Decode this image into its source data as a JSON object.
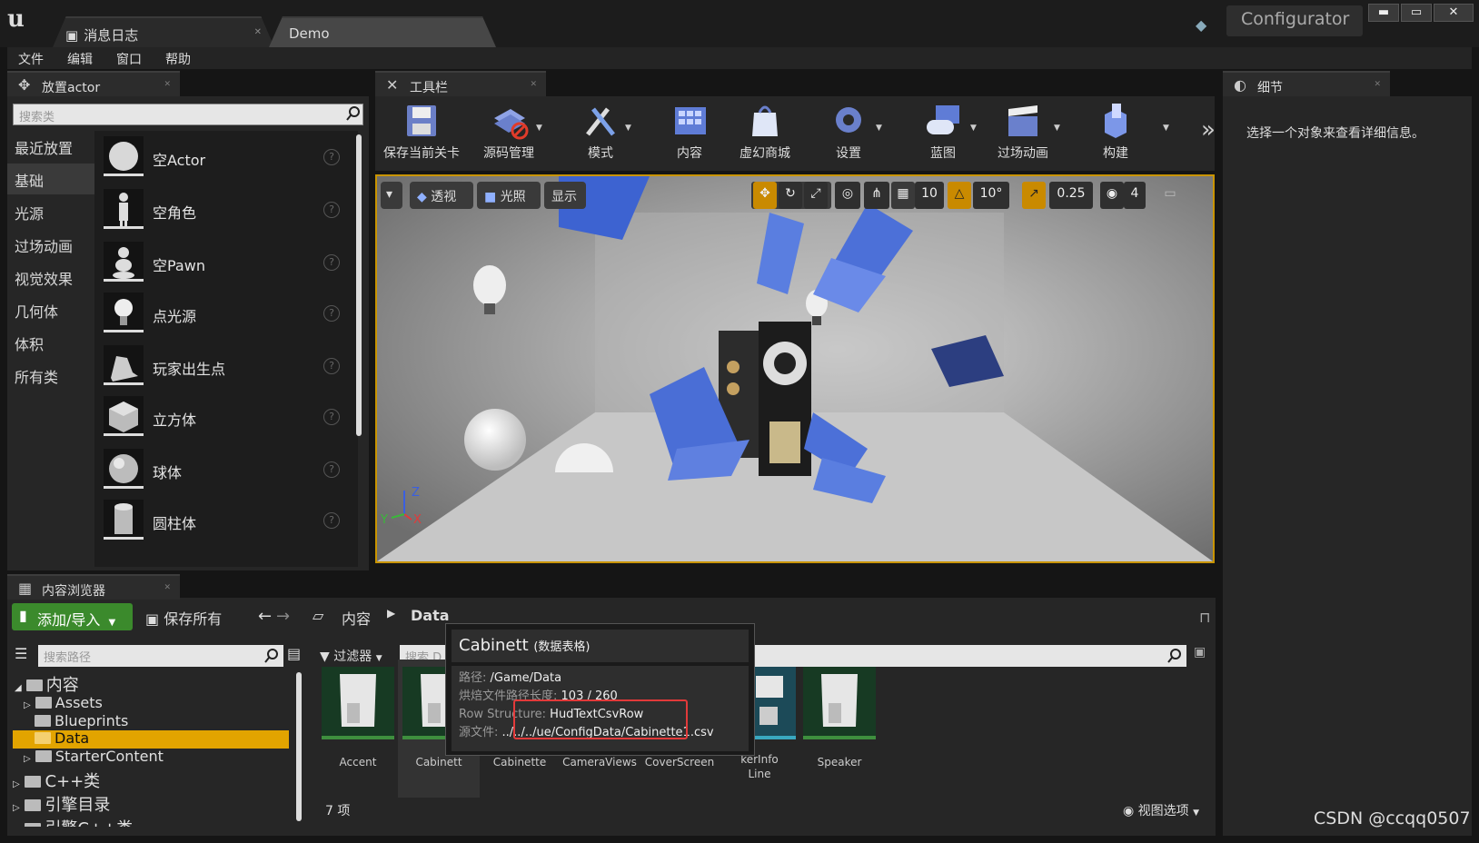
{
  "window": {
    "tabs": [
      {
        "label": "消息日志"
      },
      {
        "label": "Demo"
      }
    ],
    "project_name": "Configurator",
    "controls": {
      "minimize": "▬",
      "maximize": "▭",
      "close": "✕"
    }
  },
  "menu": [
    "文件",
    "编辑",
    "窗口",
    "帮助"
  ],
  "place_panel": {
    "title": "放置actor",
    "search_placeholder": "搜索类",
    "categories": [
      "最近放置",
      "基础",
      "光源",
      "过场动画",
      "视觉效果",
      "几何体",
      "体积",
      "所有类"
    ],
    "selected_category": "基础",
    "actors": [
      "空Actor",
      "空角色",
      "空Pawn",
      "点光源",
      "玩家出生点",
      "立方体",
      "球体",
      "圆柱体"
    ],
    "help_glyph": "?"
  },
  "toolbar": {
    "title": "工具栏",
    "buttons": [
      {
        "label": "保存当前关卡",
        "icon": "save-icon"
      },
      {
        "label": "源码管理",
        "icon": "source-control-icon"
      },
      {
        "label": "模式",
        "icon": "modes-icon"
      },
      {
        "label": "内容",
        "icon": "content-icon"
      },
      {
        "label": "虚幻商城",
        "icon": "marketplace-icon"
      },
      {
        "label": "设置",
        "icon": "settings-icon"
      },
      {
        "label": "蓝图",
        "icon": "blueprint-icon"
      },
      {
        "label": "过场动画",
        "icon": "cinematics-icon"
      },
      {
        "label": "构建",
        "icon": "build-icon"
      }
    ],
    "more": "»"
  },
  "viewport": {
    "buttons": {
      "perspective": "透视",
      "lighting": "光照",
      "show": "显示"
    },
    "grid_snap": "10",
    "rotation_snap": "10°",
    "scale_snap": "0.25",
    "camera_speed": "4",
    "axis_labels": {
      "z": "Z",
      "x": "X",
      "y": "Y"
    }
  },
  "details": {
    "title": "细节",
    "empty_message": "选择一个对象来查看详细信息。"
  },
  "content_browser": {
    "title": "内容浏览器",
    "add_import": "添加/导入",
    "save_all": "保存所有",
    "breadcrumb": [
      "内容",
      "Data"
    ],
    "search_path_placeholder": "搜索路径",
    "filter_label": "过滤器",
    "search_assets_placeholder": "搜索 D",
    "tree": [
      {
        "label": "内容",
        "level": 0,
        "expanded": true
      },
      {
        "label": "Assets",
        "level": 1
      },
      {
        "label": "Blueprints",
        "level": 1
      },
      {
        "label": "Data",
        "level": 1,
        "selected": true
      },
      {
        "label": "StarterContent",
        "level": 1
      },
      {
        "label": "C++类",
        "level": 0
      },
      {
        "label": "引擎目录",
        "level": 0
      },
      {
        "label": "引擎C++类",
        "level": 0
      }
    ],
    "assets": [
      "Accent",
      "Cabinett",
      "Cabinette",
      "CameraViews",
      "CoverScreen",
      "kerInfo\nLine",
      "Speaker"
    ],
    "item_count": "7 项",
    "view_options": "视图选项"
  },
  "tooltip": {
    "title": "Cabinett",
    "type": "(数据表格)",
    "rows": [
      {
        "key": "路径:",
        "value": "/Game/Data"
      },
      {
        "key": "烘焙文件路径长度:",
        "value": "103 / 260"
      },
      {
        "key": "Row Structure:",
        "value": "HudTextCsvRow"
      },
      {
        "key": "源文件:",
        "value": "../../../ue/ConfigData/Cabinette1.csv"
      }
    ]
  },
  "watermark": "CSDN @ccqq0507",
  "colors": {
    "accent_gold": "#c99400",
    "add_green": "#3b8a2c",
    "highlight_red": "#e23a3a",
    "selected_folder": "#e2a400"
  }
}
